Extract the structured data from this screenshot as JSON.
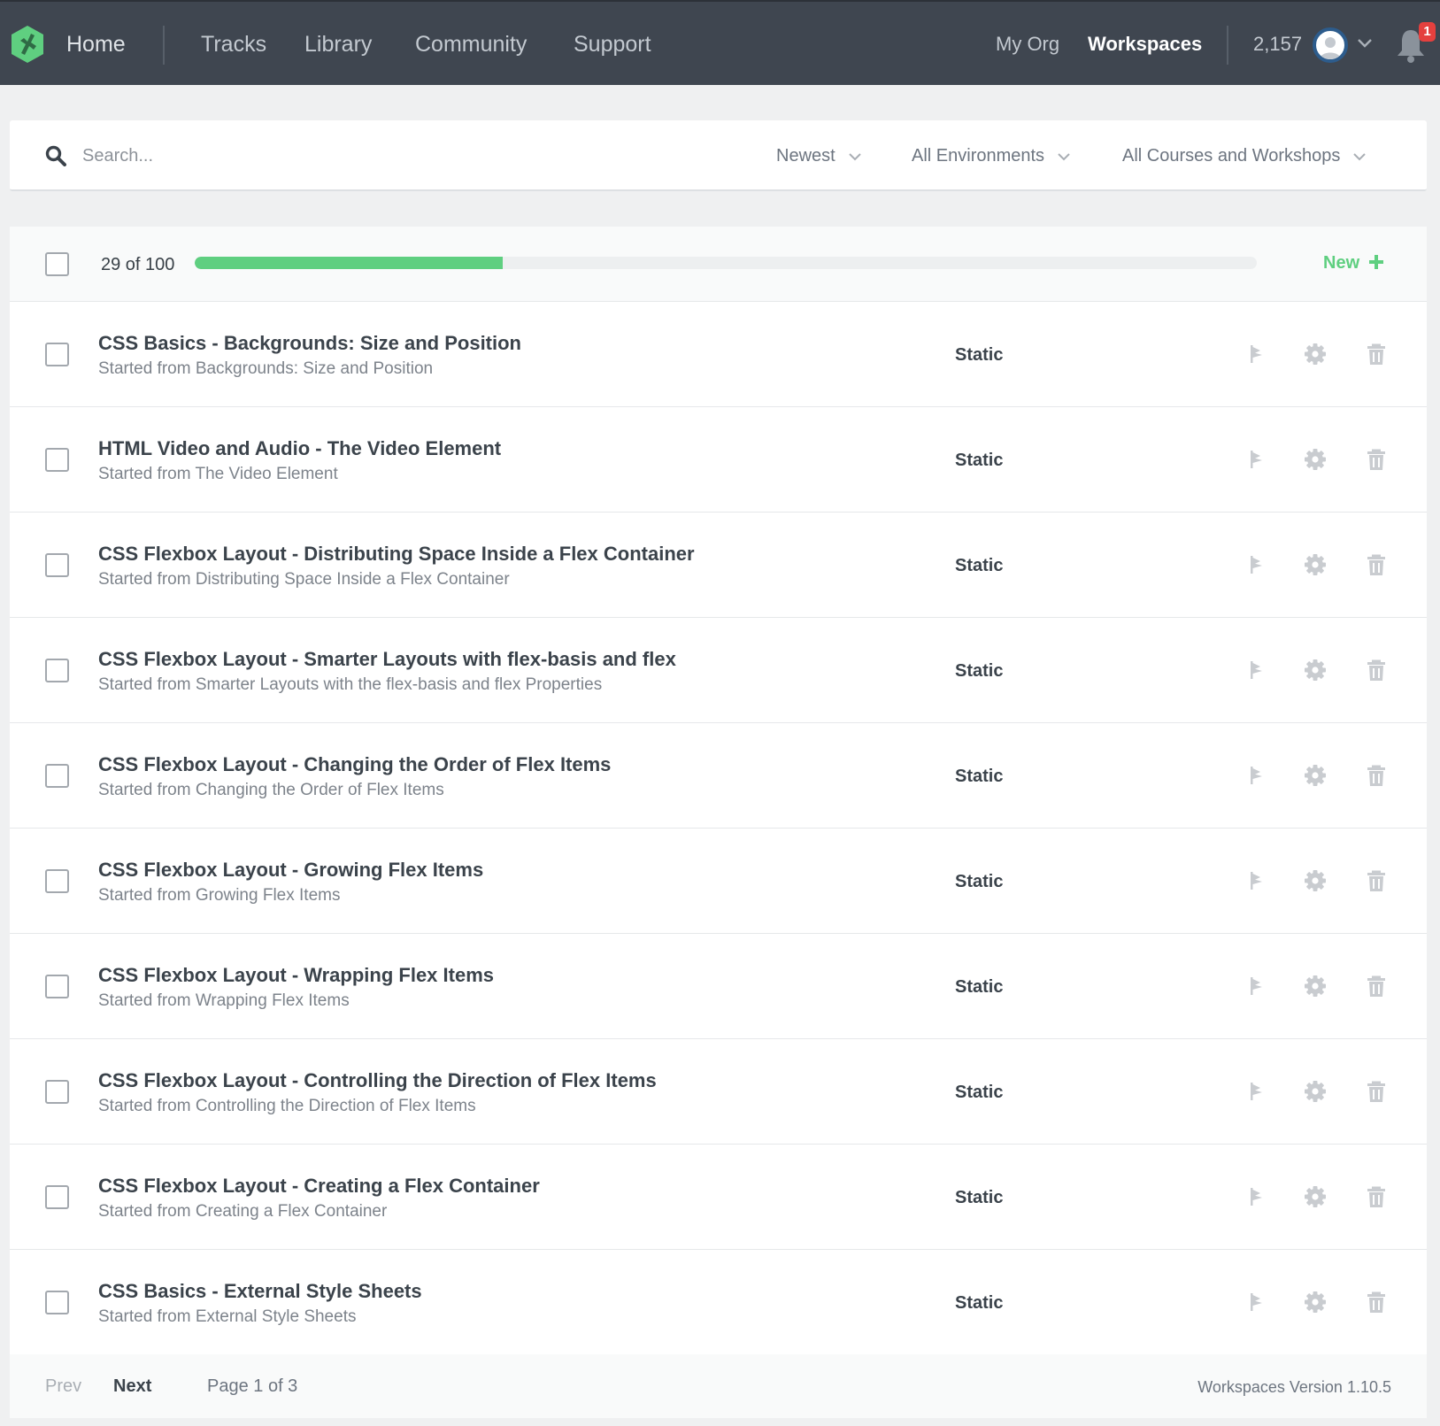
{
  "nav": {
    "home": "Home",
    "links": [
      "Tracks",
      "Library",
      "Community",
      "Support"
    ],
    "my_org": "My Org",
    "workspaces": "Workspaces",
    "points": "2,157",
    "notification_count": "1"
  },
  "filters": {
    "search_placeholder": "Search...",
    "sort": "Newest",
    "environment": "All Environments",
    "courses": "All Courses and Workshops"
  },
  "list": {
    "count_text": "29 of 100",
    "progress_fraction": 0.29,
    "new_label": "New",
    "rows": [
      {
        "title": "CSS Basics - Backgrounds: Size and Position",
        "subtitle": "Started from Backgrounds: Size and Position",
        "env": "Static"
      },
      {
        "title": "HTML Video and Audio - The Video Element",
        "subtitle": "Started from The Video Element",
        "env": "Static"
      },
      {
        "title": "CSS Flexbox Layout - Distributing Space Inside a Flex Container",
        "subtitle": "Started from Distributing Space Inside a Flex Container",
        "env": "Static"
      },
      {
        "title": "CSS Flexbox Layout - Smarter Layouts with flex-basis and flex",
        "subtitle": "Started from Smarter Layouts with the flex-basis and flex Properties",
        "env": "Static"
      },
      {
        "title": "CSS Flexbox Layout - Changing the Order of Flex Items",
        "subtitle": "Started from Changing the Order of Flex Items",
        "env": "Static"
      },
      {
        "title": "CSS Flexbox Layout - Growing Flex Items",
        "subtitle": "Started from Growing Flex Items",
        "env": "Static"
      },
      {
        "title": "CSS Flexbox Layout - Wrapping Flex Items",
        "subtitle": "Started from Wrapping Flex Items",
        "env": "Static"
      },
      {
        "title": "CSS Flexbox Layout - Controlling the Direction of Flex Items",
        "subtitle": "Started from Controlling the Direction of Flex Items",
        "env": "Static"
      },
      {
        "title": "CSS Flexbox Layout - Creating a Flex Container",
        "subtitle": "Started from Creating a Flex Container",
        "env": "Static"
      },
      {
        "title": "CSS Basics - External Style Sheets",
        "subtitle": "Started from External Style Sheets",
        "env": "Static"
      }
    ]
  },
  "footer": {
    "prev": "Prev",
    "next": "Next",
    "page": "Page 1 of 3",
    "version": "Workspaces Version 1.10.5"
  },
  "colors": {
    "nav_bg": "#3f4650",
    "accent_green": "#5fcf80",
    "badge_red": "#e4403e",
    "icon_gray": "#c9ccd0"
  }
}
